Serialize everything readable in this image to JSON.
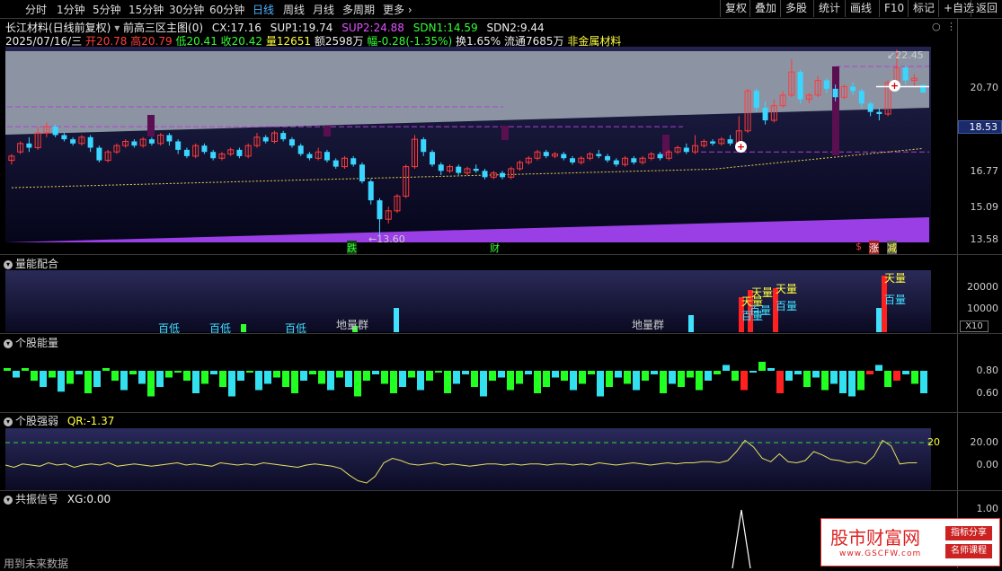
{
  "toolbar": {
    "left": [
      "分时",
      "1分钟",
      "5分钟",
      "15分钟",
      "30分钟",
      "60分钟",
      "日线",
      "周线",
      "月线",
      "多周期",
      "更多"
    ],
    "right": [
      "复权",
      "叠加",
      "多股",
      "统计",
      "画线",
      "F10",
      "标记",
      "+自选",
      "返回"
    ]
  },
  "stock": {
    "title": "长江材料(日线前复权)",
    "indicator_name": "前高三区主图(0)",
    "cx_label": "CX:",
    "cx": "17.16",
    "sup1_label": "SUP1:",
    "sup1": "19.74",
    "sup2_label": "SUP2:",
    "sup2": "24.88",
    "sdn1_label": "SDN1:",
    "sdn1": "14.59",
    "sdn2_label": "SDN2:",
    "sdn2": "9.44",
    "date": "2025/07/16/三",
    "open_label": "开",
    "open": "20.78",
    "high_label": "高",
    "high": "20.79",
    "low_label": "低",
    "low": "20.41",
    "close_label": "收",
    "close": "20.42",
    "vol_label": "量",
    "vol": "12651",
    "amount_label": "额",
    "amount": "2598万",
    "change_label": "幅",
    "change": "-0.28(-1.35%)",
    "turnover_label": "换",
    "turnover": "1.65%",
    "float_label": "流通",
    "float": "7685万",
    "sector": "非金属材料"
  },
  "main_axis": [
    "20.70",
    "18.53",
    "16.77",
    "15.09",
    "13.58"
  ],
  "main_markers": {
    "low_price": "13.60",
    "high_price": "22.45",
    "die": "跌",
    "cai": "财",
    "s": "$",
    "zhang": "涨",
    "jian": "减"
  },
  "panel1": {
    "title": "量能配合",
    "axis": [
      "20000",
      "10000"
    ],
    "unit": "X10",
    "labels": [
      "百低",
      "百低",
      "百低",
      "地量群",
      "地量群",
      "天量",
      "天量",
      "天量",
      "百量",
      "百量",
      "天量",
      "百量",
      "百量",
      "天量",
      "百量"
    ]
  },
  "panel2": {
    "title": "个股能量",
    "axis": [
      "0.80",
      "0.60"
    ]
  },
  "panel3": {
    "title": "个股强弱",
    "qr_label": "QR:",
    "qr": "-1.37",
    "axis": [
      "20.00",
      "0.00"
    ],
    "level": "20"
  },
  "panel4": {
    "title": "共振信号",
    "xg_label": "XG:",
    "xg": "0.00",
    "axis": [
      "1.00"
    ]
  },
  "footer": "用到未来数据",
  "watermark": {
    "name": "股市财富网",
    "url": "www.GSCFW.com",
    "tag1": "指标分享",
    "tag2": "名师课程"
  },
  "chart_data": {
    "type": "candlestick",
    "ylim": [
      13.3,
      22.6
    ],
    "candles": [
      [
        17.2,
        17.4,
        17.0,
        17.5
      ],
      [
        17.6,
        18.0,
        17.5,
        18.1
      ],
      [
        18.0,
        17.8,
        17.6,
        18.3
      ],
      [
        17.8,
        18.5,
        17.7,
        18.8
      ],
      [
        18.5,
        18.8,
        18.3,
        19.0
      ],
      [
        18.8,
        18.4,
        18.3,
        18.9
      ],
      [
        18.4,
        18.2,
        18.1,
        18.5
      ],
      [
        18.2,
        18.0,
        17.9,
        18.3
      ],
      [
        18.0,
        18.3,
        17.9,
        18.4
      ],
      [
        18.3,
        17.8,
        17.6,
        18.4
      ],
      [
        17.8,
        17.2,
        17.1,
        17.9
      ],
      [
        17.2,
        17.6,
        17.1,
        17.7
      ],
      [
        17.6,
        17.9,
        17.5,
        18.0
      ],
      [
        17.9,
        18.1,
        17.8,
        18.2
      ],
      [
        18.1,
        17.9,
        17.8,
        18.2
      ],
      [
        17.9,
        18.2,
        17.8,
        18.3
      ],
      [
        18.2,
        18.0,
        17.9,
        18.3
      ],
      [
        18.0,
        18.4,
        17.9,
        18.5
      ],
      [
        18.4,
        18.1,
        17.9,
        18.5
      ],
      [
        18.1,
        17.7,
        17.5,
        18.2
      ],
      [
        17.7,
        17.4,
        17.3,
        17.8
      ],
      [
        17.4,
        17.9,
        17.3,
        18.0
      ],
      [
        17.9,
        17.6,
        17.5,
        18.0
      ],
      [
        17.6,
        17.3,
        17.2,
        17.7
      ],
      [
        17.3,
        17.5,
        17.2,
        17.6
      ],
      [
        17.5,
        17.7,
        17.4,
        17.8
      ],
      [
        17.7,
        17.4,
        17.3,
        17.8
      ],
      [
        17.4,
        17.9,
        17.3,
        18.0
      ],
      [
        17.9,
        18.3,
        17.8,
        18.5
      ],
      [
        18.3,
        18.1,
        18.0,
        18.4
      ],
      [
        18.1,
        18.5,
        18.0,
        18.6
      ],
      [
        18.5,
        18.2,
        18.1,
        18.6
      ],
      [
        18.2,
        17.9,
        17.8,
        18.3
      ],
      [
        17.9,
        17.5,
        17.4,
        18.0
      ],
      [
        17.5,
        17.3,
        17.2,
        17.6
      ],
      [
        17.3,
        17.6,
        17.2,
        17.8
      ],
      [
        17.6,
        17.2,
        17.1,
        17.7
      ],
      [
        17.2,
        16.9,
        16.8,
        17.3
      ],
      [
        16.9,
        17.3,
        16.8,
        17.4
      ],
      [
        17.3,
        17.0,
        16.9,
        17.4
      ],
      [
        17.0,
        16.2,
        16.1,
        17.1
      ],
      [
        16.2,
        15.3,
        15.1,
        16.3
      ],
      [
        15.3,
        14.4,
        13.6,
        15.4
      ],
      [
        14.4,
        14.8,
        14.2,
        15.0
      ],
      [
        14.8,
        15.5,
        14.7,
        15.6
      ],
      [
        15.5,
        16.9,
        15.4,
        17.0
      ],
      [
        16.9,
        18.2,
        16.8,
        18.4
      ],
      [
        18.2,
        17.6,
        17.4,
        18.3
      ],
      [
        17.6,
        17.0,
        16.9,
        17.7
      ],
      [
        17.0,
        16.7,
        16.5,
        17.1
      ],
      [
        16.7,
        16.9,
        16.6,
        17.0
      ],
      [
        16.9,
        16.6,
        16.5,
        17.0
      ],
      [
        16.6,
        16.8,
        16.5,
        16.9
      ],
      [
        16.8,
        16.7,
        16.6,
        17.0
      ],
      [
        16.7,
        16.4,
        16.3,
        16.8
      ],
      [
        16.4,
        16.6,
        16.3,
        16.7
      ],
      [
        16.6,
        16.4,
        16.3,
        16.7
      ],
      [
        16.4,
        16.8,
        16.3,
        16.9
      ],
      [
        16.8,
        17.1,
        16.7,
        17.2
      ],
      [
        17.1,
        17.3,
        17.0,
        17.4
      ],
      [
        17.3,
        17.6,
        17.2,
        17.7
      ],
      [
        17.6,
        17.4,
        17.3,
        17.7
      ],
      [
        17.4,
        17.5,
        17.3,
        17.6
      ],
      [
        17.5,
        17.3,
        17.2,
        17.6
      ],
      [
        17.3,
        17.1,
        17.0,
        17.4
      ],
      [
        17.1,
        17.3,
        17.0,
        17.4
      ],
      [
        17.3,
        17.5,
        17.2,
        17.6
      ],
      [
        17.5,
        17.4,
        17.3,
        17.7
      ],
      [
        17.4,
        17.2,
        17.1,
        17.5
      ],
      [
        17.2,
        17.0,
        16.9,
        17.3
      ],
      [
        17.0,
        17.3,
        16.9,
        17.4
      ],
      [
        17.3,
        17.1,
        17.0,
        17.4
      ],
      [
        17.1,
        17.3,
        17.0,
        17.4
      ],
      [
        17.3,
        17.5,
        17.2,
        17.6
      ],
      [
        17.5,
        17.3,
        17.2,
        17.6
      ],
      [
        17.3,
        17.6,
        17.2,
        17.7
      ],
      [
        17.6,
        17.8,
        17.5,
        17.9
      ],
      [
        17.8,
        17.6,
        17.5,
        18.0
      ],
      [
        17.6,
        17.9,
        17.5,
        18.4
      ],
      [
        17.9,
        18.1,
        17.8,
        18.2
      ],
      [
        18.1,
        18.0,
        17.9,
        18.2
      ],
      [
        18.0,
        18.2,
        17.9,
        18.3
      ],
      [
        18.2,
        18.0,
        17.9,
        18.4
      ],
      [
        18.0,
        18.6,
        17.9,
        19.3
      ],
      [
        18.6,
        20.5,
        18.5,
        20.6
      ],
      [
        20.5,
        19.7,
        19.5,
        20.6
      ],
      [
        19.7,
        19.1,
        18.9,
        20.0
      ],
      [
        19.1,
        19.8,
        19.0,
        20.1
      ],
      [
        19.8,
        20.3,
        19.7,
        20.5
      ],
      [
        20.3,
        21.4,
        20.2,
        22.0
      ],
      [
        21.4,
        20.1,
        19.9,
        21.5
      ],
      [
        20.1,
        20.3,
        19.9,
        20.4
      ],
      [
        20.3,
        21.0,
        20.2,
        21.2
      ],
      [
        21.0,
        20.6,
        20.4,
        21.1
      ],
      [
        20.6,
        20.2,
        20.0,
        20.8
      ],
      [
        20.2,
        20.7,
        20.1,
        20.8
      ],
      [
        20.7,
        20.5,
        20.3,
        20.9
      ],
      [
        20.5,
        19.9,
        19.7,
        20.6
      ],
      [
        19.9,
        19.5,
        19.3,
        20.0
      ],
      [
        19.5,
        19.4,
        19.1,
        19.7
      ],
      [
        19.4,
        20.9,
        19.3,
        21.0
      ],
      [
        20.9,
        21.6,
        20.5,
        22.45
      ],
      [
        21.6,
        21.0,
        20.8,
        21.7
      ],
      [
        21.0,
        21.1,
        20.7,
        21.3
      ],
      [
        20.78,
        20.42,
        20.41,
        20.79
      ]
    ],
    "support_levels": [
      19.74,
      18.8,
      17.6
    ],
    "energy": [
      0.78,
      0.72,
      0.78,
      0.7,
      0.66,
      0.72,
      0.63,
      0.68,
      0.74,
      0.62,
      0.66,
      0.78,
      0.7,
      0.64,
      0.74,
      0.68,
      0.6,
      0.66,
      0.72,
      0.76,
      0.7,
      0.62,
      0.68,
      0.74,
      0.66,
      0.6,
      0.7,
      0.76,
      0.64,
      0.68,
      0.72,
      0.66,
      0.62,
      0.7,
      0.74,
      0.68,
      0.64,
      0.72,
      0.66,
      0.6,
      0.7,
      0.74,
      0.68,
      0.62,
      0.66,
      0.72,
      0.64,
      0.7,
      0.76,
      0.62,
      0.68,
      0.74,
      0.66,
      0.6,
      0.7,
      0.72,
      0.64,
      0.68,
      0.74,
      0.62,
      0.66,
      0.72,
      0.7,
      0.64,
      0.68,
      0.74,
      0.6,
      0.66,
      0.72,
      0.68,
      0.64,
      0.7,
      0.74,
      0.62,
      0.68,
      0.66,
      0.72,
      0.64,
      0.7,
      0.74,
      0.8,
      0.7,
      0.64,
      0.76,
      0.82,
      0.78,
      0.62,
      0.7,
      0.74,
      0.66,
      0.72,
      0.64,
      0.68,
      0.62,
      0.6,
      0.64,
      0.74,
      0.8,
      0.66,
      0.7,
      0.74,
      0.68,
      0.62
    ],
    "energy_colors": "gcggcgcgcgcggcgcgcgggcgcgccgccgggcggcgcggcggcgcgggccgcgcggcggcgcggcgcgcgcgcgggcgcgrcgcrccgcgcccgrcgrcgc",
    "strength": [
      0,
      -2,
      1,
      0,
      -1,
      2,
      0,
      1,
      -2,
      0,
      1,
      0,
      2,
      -1,
      0,
      1,
      0,
      -1,
      0,
      1,
      2,
      0,
      1,
      0,
      -1,
      2,
      1,
      0,
      1,
      0,
      2,
      1,
      0,
      -1,
      -2,
      0,
      1,
      0,
      -1,
      -3,
      -9,
      -14,
      -16,
      -10,
      2,
      6,
      4,
      1,
      0,
      1,
      2,
      0,
      1,
      0,
      -1,
      0,
      1,
      1,
      0,
      1,
      0,
      1,
      1,
      0,
      1,
      1,
      0,
      1,
      0,
      2,
      1,
      0,
      1,
      2,
      1,
      0,
      1,
      2,
      1,
      2,
      2,
      3,
      3,
      2,
      4,
      12,
      22,
      16,
      6,
      3,
      10,
      3,
      2,
      4,
      12,
      9,
      5,
      4,
      2,
      3,
      1,
      8,
      22,
      17,
      1,
      2,
      2
    ]
  }
}
